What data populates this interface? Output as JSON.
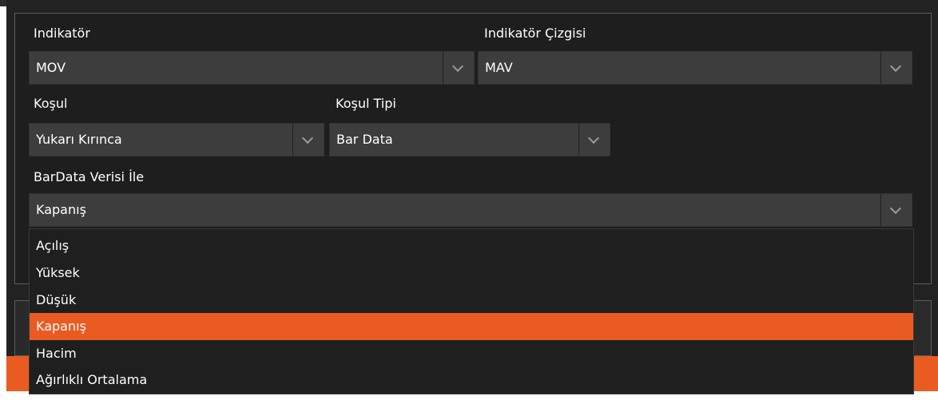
{
  "form": {
    "indicator": {
      "label": "Indikatör",
      "value": "MOV"
    },
    "indicator_line": {
      "label": "Indikatör Çizgisi",
      "value": "MAV"
    },
    "condition": {
      "label": "Koşul",
      "value": "Yukarı Kırınca"
    },
    "condition_type": {
      "label": "Koşul Tipi",
      "value": "Bar Data"
    },
    "bardata": {
      "label": "BarData Verisi İle",
      "value": "Kapanış"
    }
  },
  "dropdown": {
    "options": [
      "Açılış",
      "Yüksek",
      "Düşük",
      "Kapanış",
      "Hacim",
      "Ağırlıklı Ortalama"
    ],
    "selected": "Kapanış"
  },
  "colors": {
    "accent": "#ea5b22",
    "background": "#222222",
    "field": "#3d3d3d"
  },
  "icons": {
    "select_arrow": "chevron-down-icon"
  }
}
